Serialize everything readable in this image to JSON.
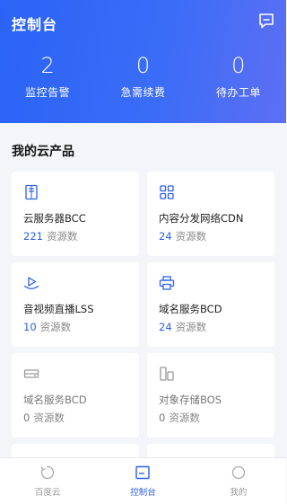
{
  "header": {
    "title": "控制台",
    "stats": [
      {
        "value": "2",
        "label": "监控告警"
      },
      {
        "value": "0",
        "label": "急需续费"
      },
      {
        "value": "0",
        "label": "待办工单"
      }
    ]
  },
  "section_title": "我的云产品",
  "count_unit": "资源数",
  "products": [
    {
      "name": "云服务器BCC",
      "count": "221",
      "icon": "server-icon",
      "enabled": true
    },
    {
      "name": "内容分发网络CDN",
      "count": "24",
      "icon": "grid-apps-icon",
      "enabled": true
    },
    {
      "name": "音视频直播LSS",
      "count": "10",
      "icon": "live-stream-icon",
      "enabled": true
    },
    {
      "name": "域名服务BCD",
      "count": "24",
      "icon": "printer-icon",
      "enabled": true
    },
    {
      "name": "域名服务BCD",
      "count": "0",
      "icon": "storage-box-icon",
      "enabled": false
    },
    {
      "name": "对象存储BOS",
      "count": "0",
      "icon": "storage-bucket-icon",
      "enabled": false
    }
  ],
  "tabbar": [
    {
      "label": "百度云",
      "icon": "refresh-circle-icon",
      "active": false
    },
    {
      "label": "控制台",
      "icon": "console-icon",
      "active": true
    },
    {
      "label": "我的",
      "icon": "user-circle-icon",
      "active": false
    }
  ],
  "colors": {
    "primary": "#2a5fe8",
    "header_gradient_start": "#2b63f6",
    "header_gradient_end": "#5d6ff3",
    "background": "#f4f5f8",
    "inactive_text": "#999999"
  }
}
